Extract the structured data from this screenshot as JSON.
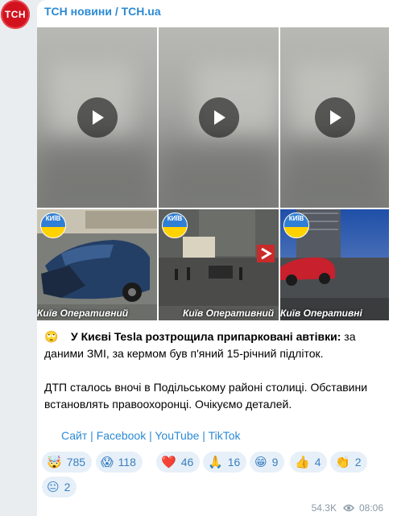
{
  "channel": {
    "name": "ТСН новини / TCH.ua",
    "avatar_text": "TCH"
  },
  "photos": [
    {
      "label": "Київ Оперативний"
    },
    {
      "label": "Київ Оперативний"
    },
    {
      "label": "Київ Оперативні"
    }
  ],
  "kyiv_badge": "КИЇВ",
  "post": {
    "emoji": "🙄",
    "bold": "У Києві Tesla розтрощила припарковані автівки:",
    "line1_rest": " за даними ЗМІ, за кермом був п'яний 15-річний підліток.",
    "para2": "ДТП сталось вночі в Подільському районі столиці. Обставини встановлять правоохоронці. Очікуємо деталей."
  },
  "links": {
    "site": "Сайт",
    "facebook": "Facebook",
    "youtube": "YouTube",
    "tiktok": "TikTok",
    "sep": " | "
  },
  "reactions": [
    {
      "emoji": "🤯",
      "count": "785"
    },
    {
      "emoji": "😱",
      "count": "118"
    },
    {
      "emoji": "❤️",
      "count": "46"
    },
    {
      "emoji": "🙏",
      "count": "16"
    },
    {
      "emoji": "😁",
      "count": "9"
    },
    {
      "emoji": "👍",
      "count": "4"
    },
    {
      "emoji": "👏",
      "count": "2"
    },
    {
      "emoji": "😐",
      "count": "2"
    }
  ],
  "meta": {
    "views": "54.3K",
    "time": "08:06"
  },
  "colors": {
    "accent": "#2b8ad4",
    "avatar": "#d2131f"
  }
}
